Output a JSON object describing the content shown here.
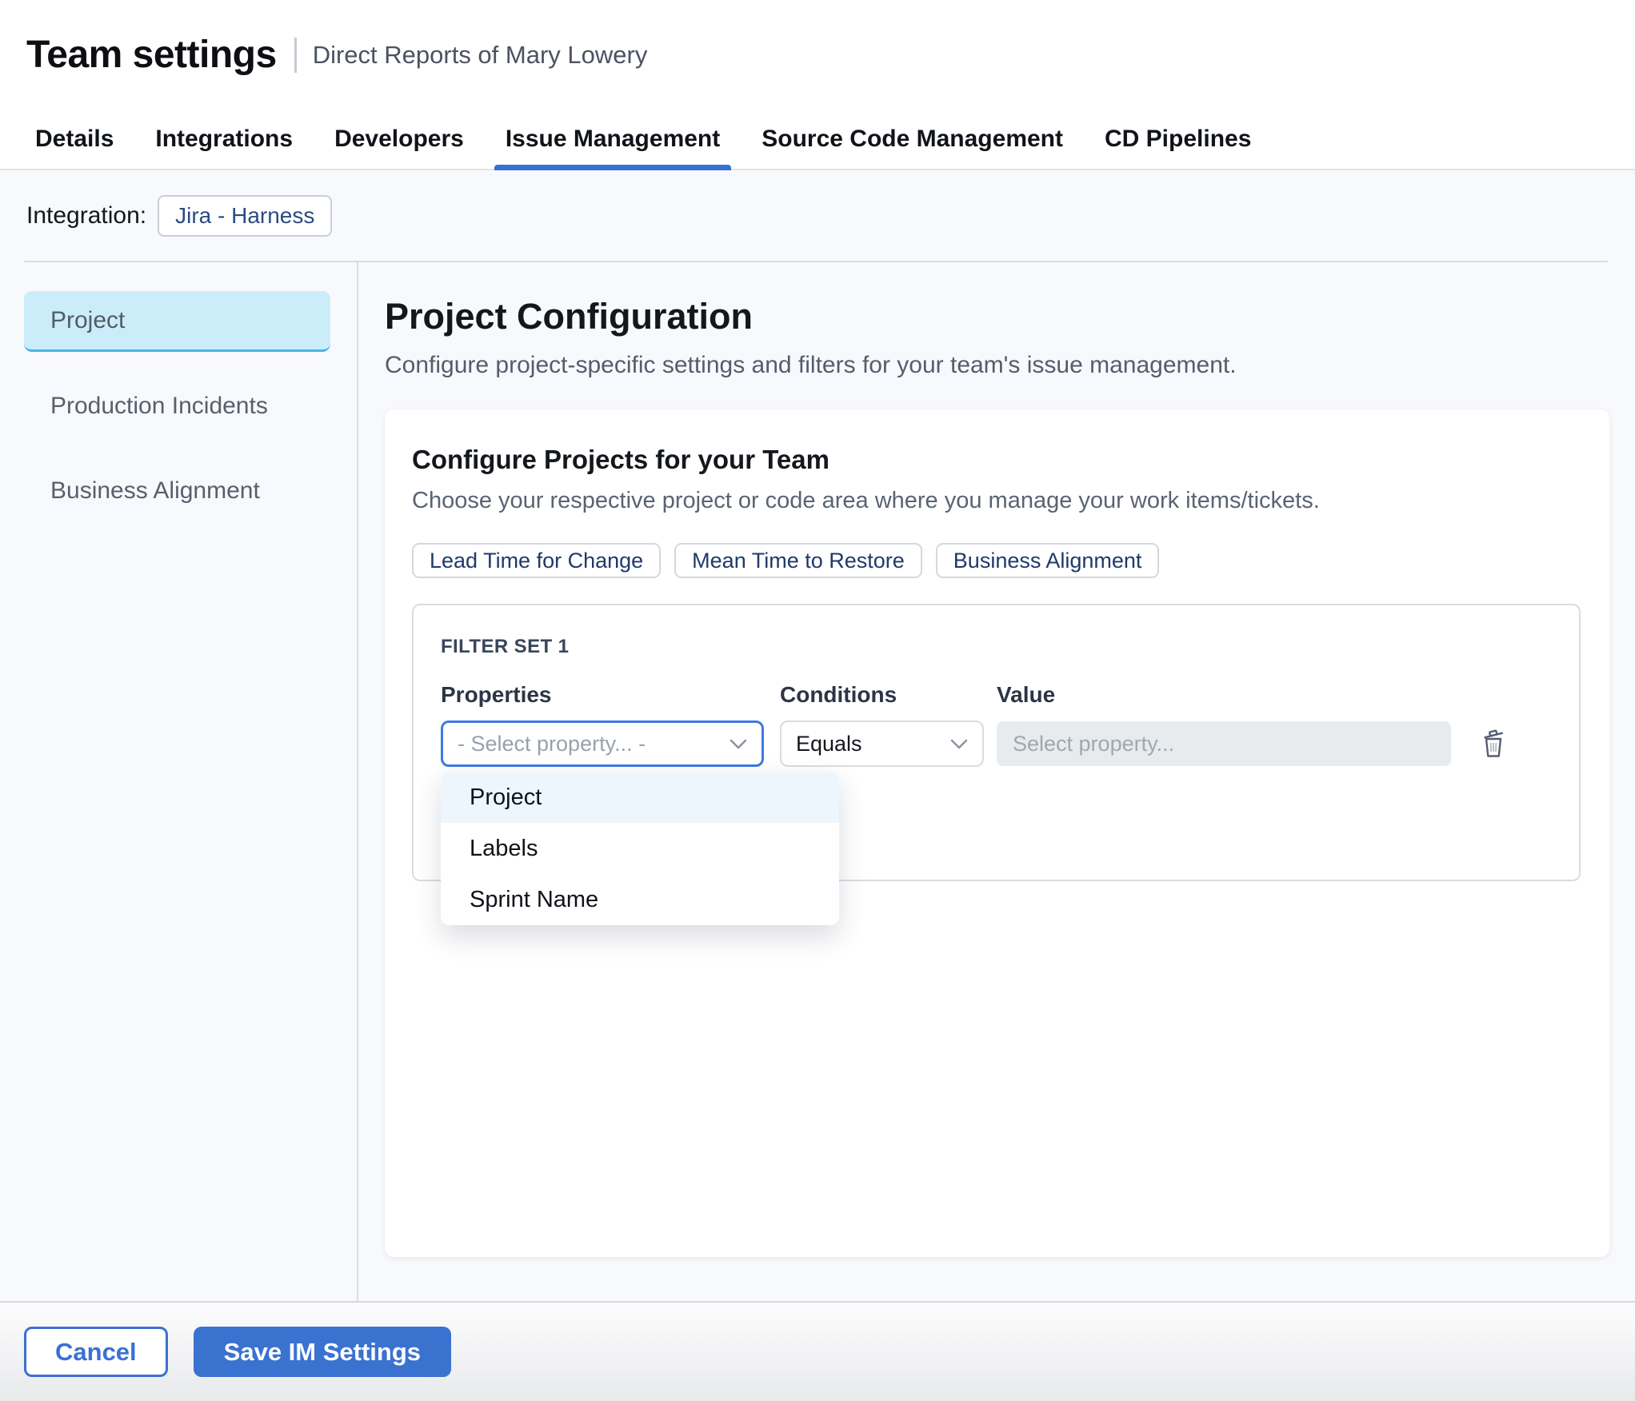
{
  "header": {
    "title": "Team settings",
    "subtitle": "Direct Reports of Mary Lowery"
  },
  "tabs": [
    {
      "label": "Details",
      "active": false
    },
    {
      "label": "Integrations",
      "active": false
    },
    {
      "label": "Developers",
      "active": false
    },
    {
      "label": "Issue Management",
      "active": true
    },
    {
      "label": "Source Code Management",
      "active": false
    },
    {
      "label": "CD Pipelines",
      "active": false
    }
  ],
  "integration": {
    "label": "Integration:",
    "value": "Jira - Harness"
  },
  "sidebar": {
    "items": [
      {
        "label": "Project",
        "active": true
      },
      {
        "label": "Production Incidents",
        "active": false
      },
      {
        "label": "Business Alignment",
        "active": false
      }
    ]
  },
  "main": {
    "title": "Project Configuration",
    "subtitle": "Configure project-specific settings and filters for your team's issue management.",
    "card": {
      "title": "Configure Projects for your Team",
      "subtitle": "Choose your respective project or code area where you manage your work items/tickets.",
      "pills": [
        {
          "label": "Lead Time for Change"
        },
        {
          "label": "Mean Time to Restore"
        },
        {
          "label": "Business Alignment"
        }
      ],
      "filter_set": {
        "title": "FILTER SET 1",
        "properties_label": "Properties",
        "conditions_label": "Conditions",
        "value_label": "Value",
        "properties_selected": "- Select property... -",
        "conditions_selected": "Equals",
        "value_placeholder": "Select property...",
        "dropdown": {
          "options": [
            {
              "label": "Project",
              "highlighted": true
            },
            {
              "label": "Labels",
              "highlighted": false
            },
            {
              "label": "Sprint Name",
              "highlighted": false
            }
          ]
        }
      }
    }
  },
  "footer": {
    "cancel": "Cancel",
    "save": "Save IM Settings"
  },
  "colors": {
    "accent_blue": "#3a72d4",
    "tab_underline": "#3471d3",
    "focus_blue": "#3d79e2",
    "active_sidebar_bg": "#cbedf9",
    "active_sidebar_border": "#49b4e8",
    "dropdown_highlight": "#edf6fc",
    "disabled_input_bg": "#e7ebee",
    "page_bg": "#f8f9fc",
    "pill_text": "#20396a",
    "chip_text": "#2b4a80"
  }
}
